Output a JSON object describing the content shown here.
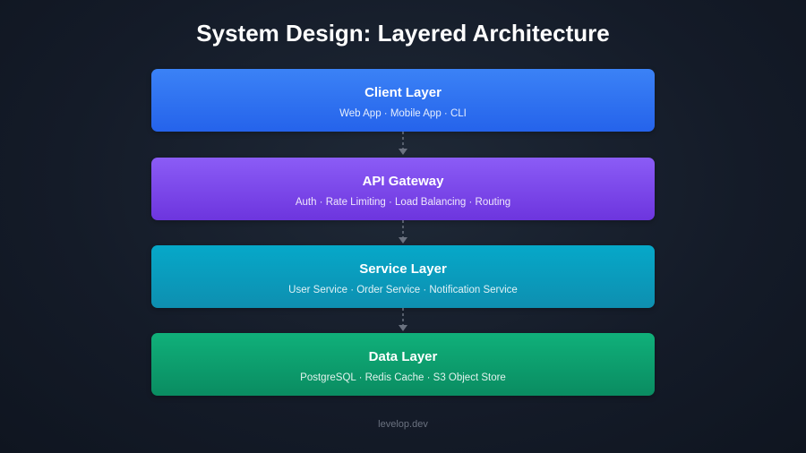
{
  "title": "System Design: Layered Architecture",
  "layers": [
    {
      "name": "Client Layer",
      "description": "Web App · Mobile App · CLI",
      "color": "#2f6ff0"
    },
    {
      "name": "API Gateway",
      "description": "Auth · Rate Limiting · Load Balancing · Routing",
      "color": "#7c44e8"
    },
    {
      "name": "Service Layer",
      "description": "User Service · Order Service · Notification Service",
      "color": "#0a9cbd"
    },
    {
      "name": "Data Layer",
      "description": "PostgreSQL · Redis Cache · S3 Object Store",
      "color": "#0d9e6d"
    }
  ],
  "connector_color": "#6b7280",
  "footer": "levelop.dev"
}
